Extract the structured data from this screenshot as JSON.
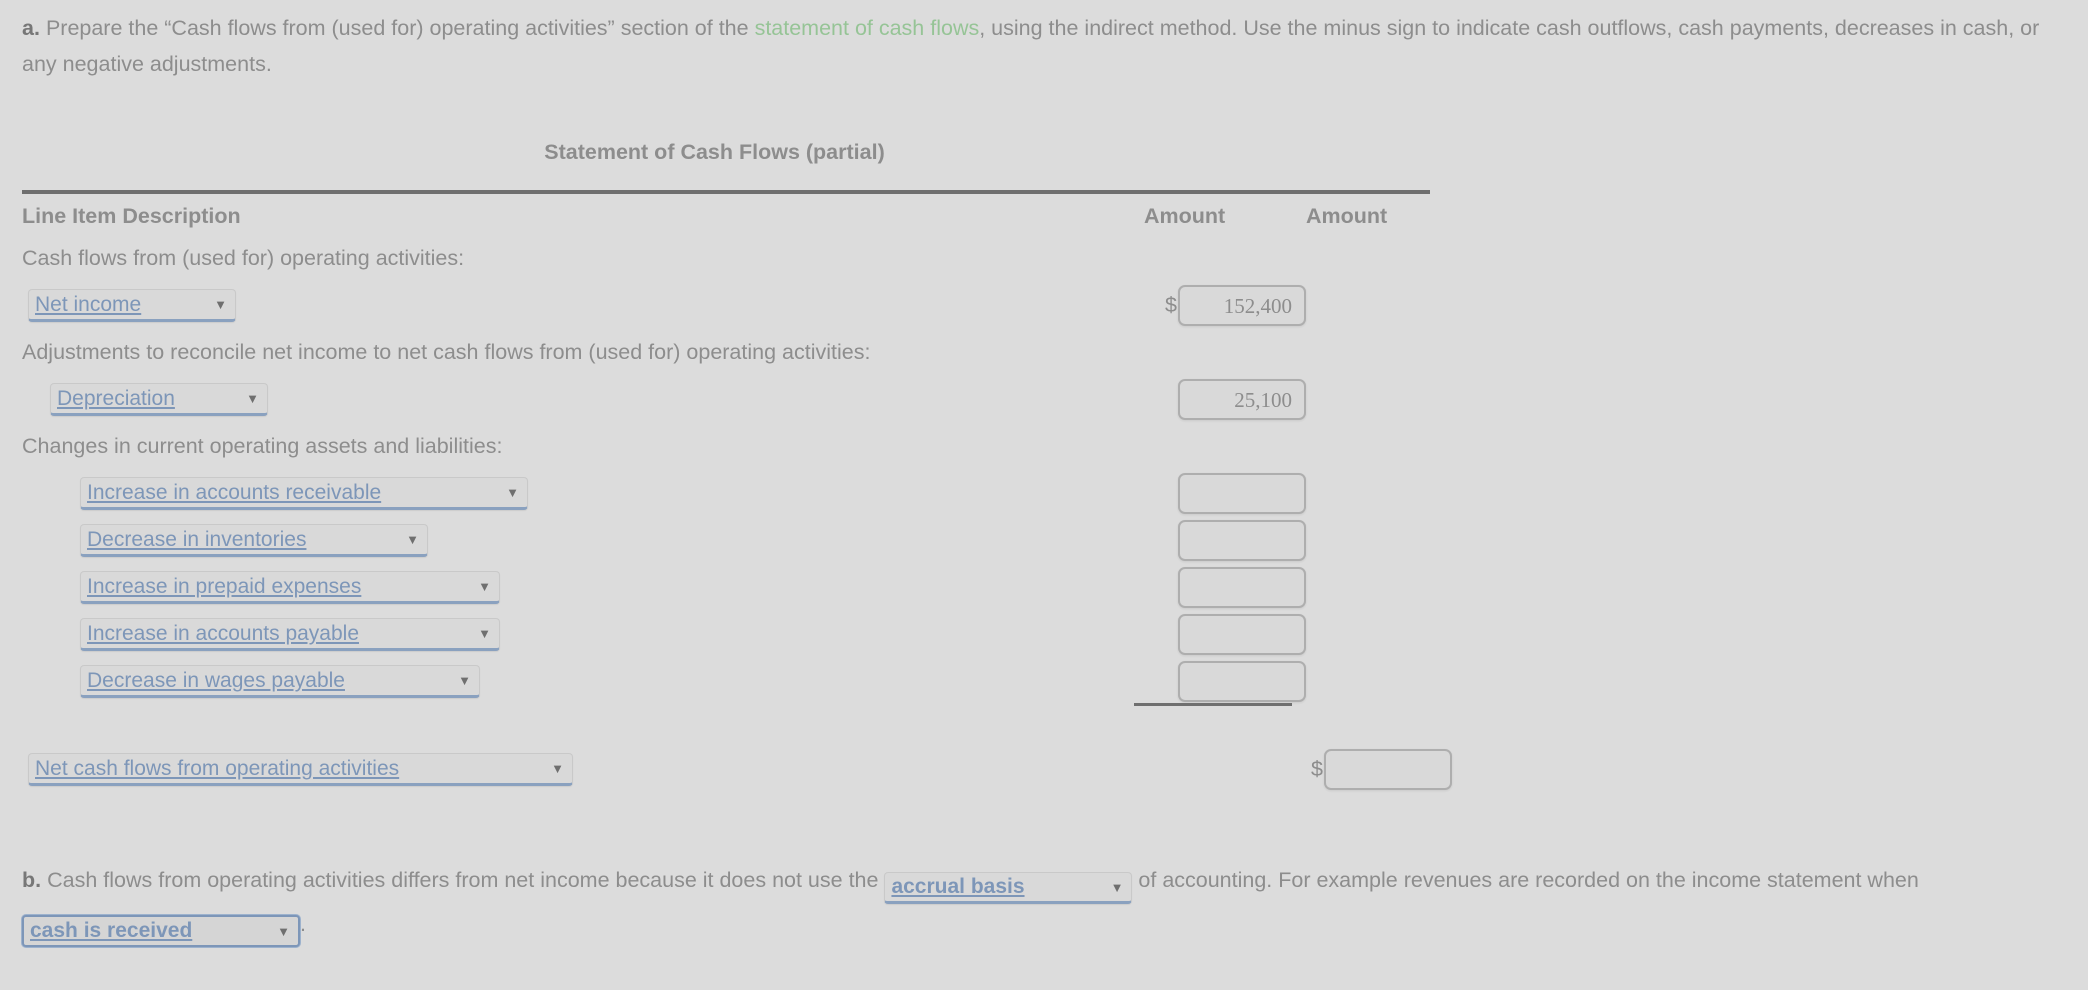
{
  "part_a": {
    "marker": "a.",
    "text_1": "Prepare the “Cash flows from (used for) operating activities” section of the ",
    "link_text": "statement of cash flows",
    "text_2": ", using the indirect method. Use the minus sign to indicate cash outflows, cash payments, decreases in cash, or any negative adjustments.",
    "link_color": "#96c496"
  },
  "statement": {
    "title": "Statement of Cash Flows (partial)",
    "columns": {
      "description": "Line Item Description",
      "amount_1": "Amount",
      "amount_2": "Amount"
    },
    "rows": [
      {
        "type": "label",
        "indent": 0,
        "label": "Cash flows from (used for) operating activities:"
      },
      {
        "type": "select",
        "indent": 1,
        "select_label": "Net income",
        "amount_col": 1,
        "dollar_sign": "$",
        "amount_value": "152,400"
      },
      {
        "type": "label",
        "indent": 0,
        "label": "Adjustments to reconcile net income to net cash flows from (used for) operating activities:"
      },
      {
        "type": "select",
        "indent": 2,
        "select_label": "Depreciation",
        "amount_col": 1,
        "dollar_sign": "",
        "amount_value": "25,100"
      },
      {
        "type": "label",
        "indent": 0,
        "label": "Changes in current operating assets and liabilities:"
      },
      {
        "type": "select",
        "indent": 3,
        "select_label": "Increase in accounts receivable",
        "amount_col": 1,
        "dollar_sign": "",
        "amount_value": ""
      },
      {
        "type": "select",
        "indent": 3,
        "select_label": "Decrease in inventories",
        "amount_col": 1,
        "dollar_sign": "",
        "amount_value": ""
      },
      {
        "type": "select",
        "indent": 3,
        "select_label": "Increase in prepaid expenses",
        "amount_col": 1,
        "dollar_sign": "",
        "amount_value": ""
      },
      {
        "type": "select",
        "indent": 3,
        "select_label": "Increase in accounts payable",
        "amount_col": 1,
        "dollar_sign": "",
        "amount_value": ""
      },
      {
        "type": "select",
        "indent": 3,
        "select_label": "Decrease in wages payable",
        "amount_col": 1,
        "dollar_sign": "",
        "amount_value": ""
      },
      {
        "type": "total",
        "indent": 1,
        "select_label": "Net cash flows from operating activities",
        "amount_col": 2,
        "dollar_sign": "$",
        "amount_value": ""
      }
    ],
    "caret_glyph": "▼"
  },
  "part_b": {
    "marker": "b.",
    "text_1": "Cash flows from operating activities differs from net income because it does not use the ",
    "select_1": "accrual basis",
    "text_2": " of accounting. For example revenues are recorded on the income statement when ",
    "select_2": "cash is received",
    "text_3": "."
  },
  "colors": {
    "background": "#dcdcdc",
    "body_text": "#8d8d8d",
    "rule": "#6f6f6f",
    "select_text": "#7d96b8",
    "link_green": "#96c496",
    "input_border": "#aeaeae"
  }
}
